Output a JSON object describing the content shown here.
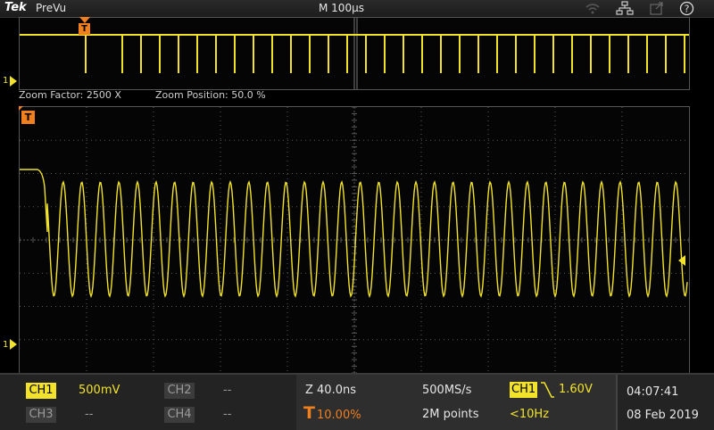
{
  "header": {
    "brand": "Tek",
    "mode": "PreVu",
    "timebase": "M 100µs",
    "icons": [
      "wifi-icon",
      "network-icon",
      "export-icon",
      "help-icon"
    ]
  },
  "overview": {
    "trigger_marker": "T",
    "channel_marker": "1"
  },
  "zoom": {
    "factor_label": "Zoom Factor: 2500 X",
    "position_label": "Zoom Position: 50.0 %"
  },
  "main": {
    "trigger_marker": "T",
    "channel_marker": "1"
  },
  "channels": [
    {
      "label": "CH1",
      "value": "500mV",
      "active": true
    },
    {
      "label": "CH2",
      "value": "--",
      "active": false
    },
    {
      "label": "CH3",
      "value": "--",
      "active": false
    },
    {
      "label": "CH4",
      "value": "--",
      "active": false
    }
  ],
  "acquisition": {
    "zoom_scale": "Z 40.0ns",
    "trigger_symbol": "T",
    "trigger_position": "10.00%",
    "sample_rate": "500MS/s",
    "record_length": "2M points",
    "trigger_source": "CH1",
    "trigger_level": "1.60V",
    "trigger_frequency": "<10Hz"
  },
  "clock": {
    "time": "04:07:41",
    "date": "08 Feb 2019"
  },
  "colors": {
    "ch1": "#f2e32a",
    "trigger": "#f07f1e",
    "grid": "#5a5a5a",
    "background": "#000000"
  }
}
